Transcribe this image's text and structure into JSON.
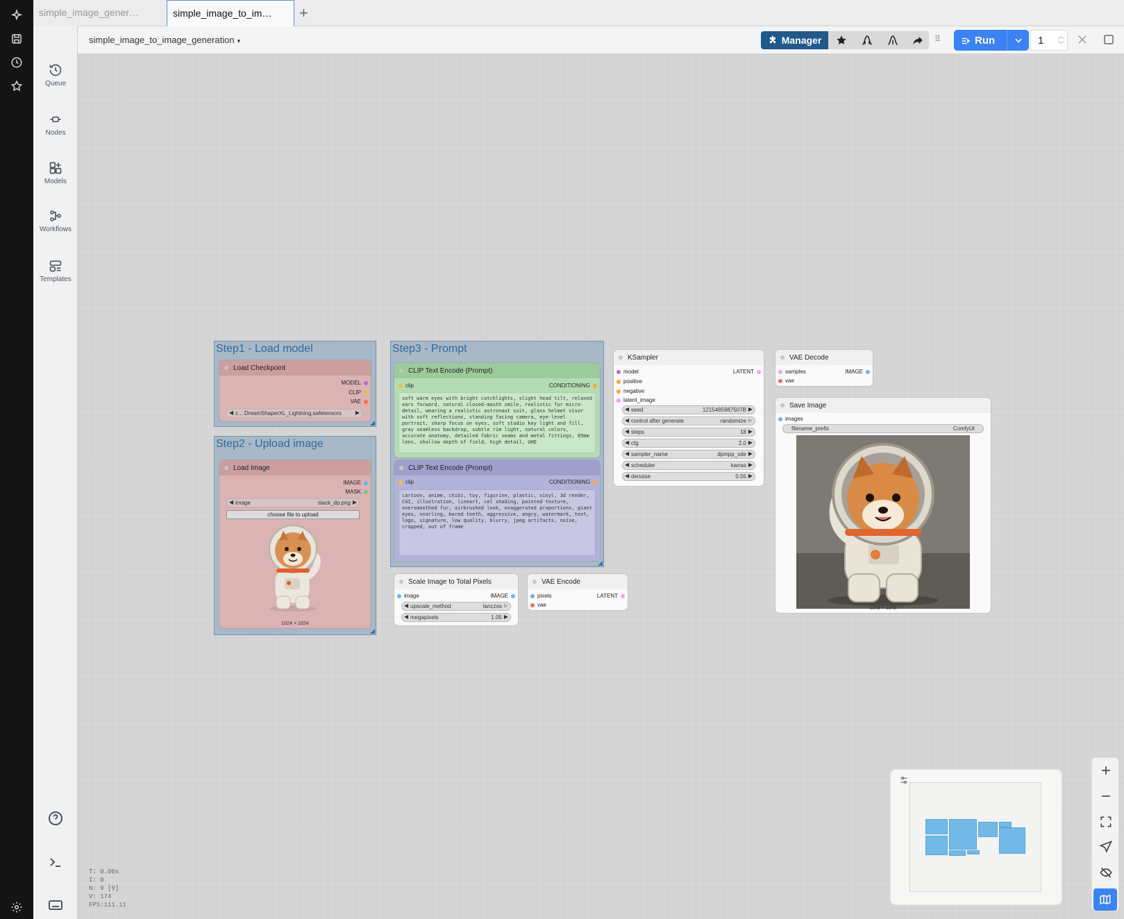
{
  "tabs": [
    {
      "label": "simple_image_gener…",
      "active": false
    },
    {
      "label": "simple_image_to_im…",
      "active": true
    }
  ],
  "toolbar": {
    "logo": "C",
    "workflow_title": "simple_image_to_image_generation",
    "manager_label": "Manager",
    "run_label": "Run",
    "run_count": "1"
  },
  "sidebar": {
    "items": [
      {
        "label": "Queue",
        "icon": "history-icon"
      },
      {
        "label": "Nodes",
        "icon": "nodes-icon"
      },
      {
        "label": "Models",
        "icon": "models-icon"
      },
      {
        "label": "Workflows",
        "icon": "workflows-icon"
      },
      {
        "label": "Templates",
        "icon": "templates-icon"
      }
    ]
  },
  "groups": {
    "step1": "Step1 - Load model",
    "step2": "Step2 - Upload image",
    "step3": "Step3 - Prompt"
  },
  "nodes": {
    "load_checkpoint": {
      "title": "Load Checkpoint",
      "outputs": [
        "MODEL",
        "CLIP",
        "VAE"
      ],
      "ckpt_value": "c... DreamShaperXL_Lightning.safetensors"
    },
    "load_image": {
      "title": "Load Image",
      "outputs": [
        "IMAGE",
        "MASK"
      ],
      "image_label": "image",
      "image_value": "slack_dp.png",
      "upload_label": "choose file to upload",
      "dims": "1024 × 1024"
    },
    "clip_pos": {
      "title": "CLIP Text Encode (Prompt)",
      "input": "clip",
      "output": "CONDITIONING",
      "text": "soft warm eyes with bright catchlights, slight head tilt, relaxed ears forward, natural closed-mouth smile, realistic fur micro-detail, wearing a realistic astronaut suit, glass helmet visor with soft reflections, standing facing camera, eye-level portrait, sharp focus on eyes, soft studio key light and fill, gray seamless backdrop, subtle rim light, natural colors, accurate anatomy, detailed fabric seams and metal fittings, 85mm lens, shallow depth of field, high detail, UHD"
    },
    "clip_neg": {
      "title": "CLIP Text Encode (Prompt)",
      "input": "clip",
      "output": "CONDITIONING",
      "text": "cartoon, anime, chibi, toy, figurine, plastic, vinyl, 3d render, CGI, illustration, lineart, cel shading, painted texture, oversmoothed fur, airbrushed look, exaggerated proportions, giant eyes, snarling, bared teeth, aggressive, angry, watermark, text, logo, signature, low quality, blurry, jpeg artifacts, noise, cropped, out of frame"
    },
    "ksampler": {
      "title": "KSampler",
      "inputs": [
        "model",
        "positive",
        "negative",
        "latent_image"
      ],
      "output": "LATENT",
      "widgets": [
        {
          "label": "seed",
          "value": "1215485987507B"
        },
        {
          "label": "control after generate",
          "value": "randomize"
        },
        {
          "label": "steps",
          "value": "18"
        },
        {
          "label": "cfg",
          "value": "2.0"
        },
        {
          "label": "sampler_name",
          "value": "dpmpp_sde"
        },
        {
          "label": "scheduler",
          "value": "karras"
        },
        {
          "label": "denoise",
          "value": "0.55"
        }
      ]
    },
    "vae_decode": {
      "title": "VAE Decode",
      "inputs": [
        "samples",
        "vae"
      ],
      "output": "IMAGE"
    },
    "save_image": {
      "title": "Save Image",
      "input": "images",
      "prefix_label": "filename_prefix",
      "prefix_value": "ComfyUI",
      "dims": "1048 × 1048"
    },
    "scale_image": {
      "title": "Scale Image to Total Pixels",
      "input": "image",
      "output": "IMAGE",
      "widgets": [
        {
          "label": "upscale_method",
          "value": "lanczos"
        },
        {
          "label": "megapixels",
          "value": "1.05"
        }
      ]
    },
    "vae_encode": {
      "title": "VAE Encode",
      "inputs": [
        "pixels",
        "vae"
      ],
      "output": "LATENT"
    }
  },
  "stats": {
    "t": "T: 0.00s",
    "i": "I: 0",
    "n": "N: 9 [9]",
    "v": "V: 174",
    "fps": "FPS:111.11"
  },
  "colors": {
    "accent": "#3b82f6",
    "manager": "#1e5a8a",
    "group_title": "#2f6aa0",
    "model_slot": "#b16ce0",
    "clip_slot": "#f0c030",
    "vae_slot": "#ff6e4a",
    "image_slot": "#64b5f6",
    "latent_slot": "#ff9cf9",
    "conditioning_slot": "#ffa931",
    "mask_slot": "#81c784"
  }
}
